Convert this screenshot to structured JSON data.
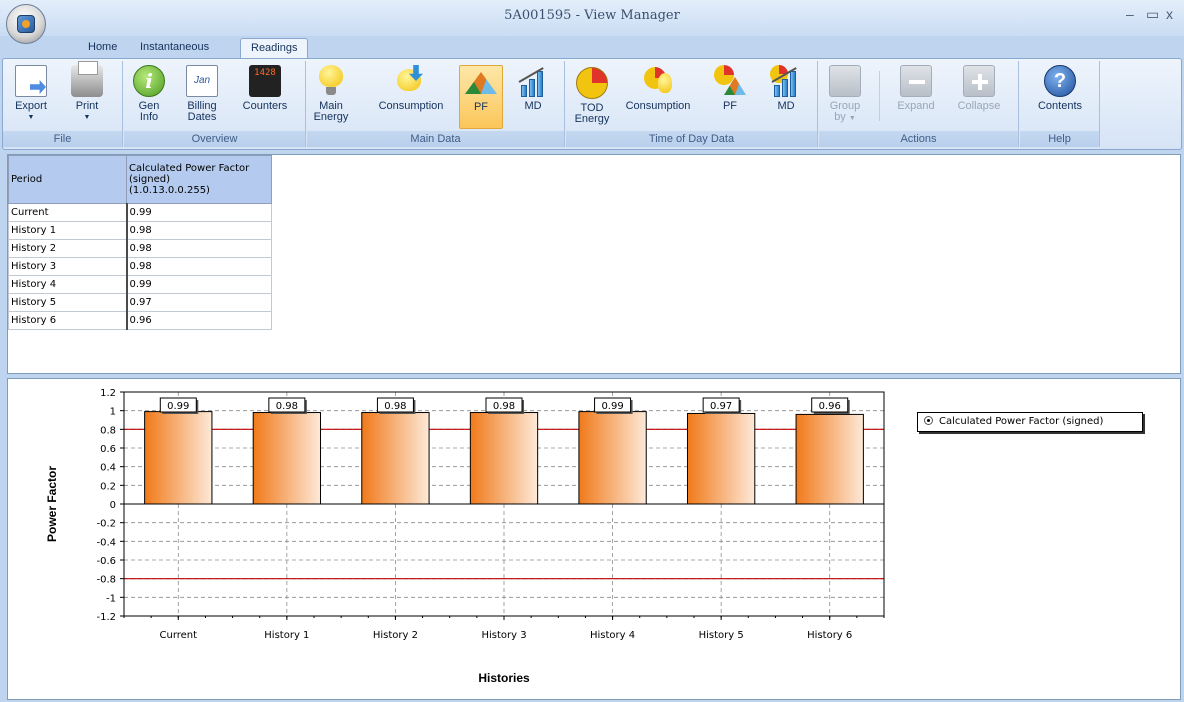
{
  "window": {
    "title": "5A001595 - View Manager",
    "minimize": "–",
    "maximize": "▭",
    "close": "x"
  },
  "tabs": [
    "Home",
    "Instantaneous",
    "Readings"
  ],
  "active_tab": "Readings",
  "ribbon": {
    "file": {
      "label": "File",
      "export": "Export",
      "print": "Print"
    },
    "overview": {
      "label": "Overview",
      "gen_info": [
        "Gen",
        "Info"
      ],
      "billing_dates": [
        "Billing",
        "Dates"
      ],
      "counters": "Counters",
      "calendar_icon_text": "Jan",
      "counter_icon_text": "1428"
    },
    "main_data": {
      "label": "Main Data",
      "main_energy": [
        "Main",
        "Energy"
      ],
      "consumption": "Consumption",
      "pf": "PF",
      "md": "MD"
    },
    "tod": {
      "label": "Time of Day Data",
      "tod_energy": [
        "TOD",
        "Energy"
      ],
      "consumption": "Consumption",
      "pf": "PF",
      "md": "MD"
    },
    "actions": {
      "label": "Actions",
      "group_by": [
        "Group",
        "by"
      ],
      "expand": "Expand",
      "collapse": "Collapse"
    },
    "help": {
      "label": "Help",
      "contents": "Contents"
    },
    "active_button": "PF"
  },
  "grid": {
    "headers": {
      "period": "Period",
      "value": [
        "Calculated Power Factor",
        "(signed)",
        "(1.0.13.0.0.255)"
      ]
    },
    "rows": [
      {
        "period": "Current",
        "value": "0.99"
      },
      {
        "period": "History 1",
        "value": "0.98"
      },
      {
        "period": "History 2",
        "value": "0.98"
      },
      {
        "period": "History 3",
        "value": "0.98"
      },
      {
        "period": "History 4",
        "value": "0.99"
      },
      {
        "period": "History 5",
        "value": "0.97"
      },
      {
        "period": "History 6",
        "value": "0.96"
      }
    ]
  },
  "chart_data": {
    "type": "bar",
    "categories": [
      "Current",
      "History 1",
      "History 2",
      "History 3",
      "History 4",
      "History 5",
      "History 6"
    ],
    "series": [
      {
        "name": "Calculated Power Factor (signed)",
        "values": [
          0.99,
          0.98,
          0.98,
          0.98,
          0.99,
          0.97,
          0.96
        ]
      }
    ],
    "data_labels": [
      "0.99",
      "0.98",
      "0.98",
      "0.98",
      "0.99",
      "0.97",
      "0.96"
    ],
    "xlabel": "Histories",
    "ylabel": "Power Factor",
    "ylim": [
      -1.2,
      1.2
    ],
    "yticks": [
      "1.2",
      "1",
      "0.8",
      "0.6",
      "0.4",
      "0.2",
      "0",
      "-0.2",
      "-0.4",
      "-0.6",
      "-0.8",
      "-1",
      "-1.2"
    ],
    "limit_lines": [
      0.8,
      -0.8
    ],
    "grid": true,
    "legend": "top-right",
    "colors": {
      "bar_dark": "#f07a1a",
      "bar_light": "#fde9d8",
      "limit_line": "#c00000"
    }
  }
}
